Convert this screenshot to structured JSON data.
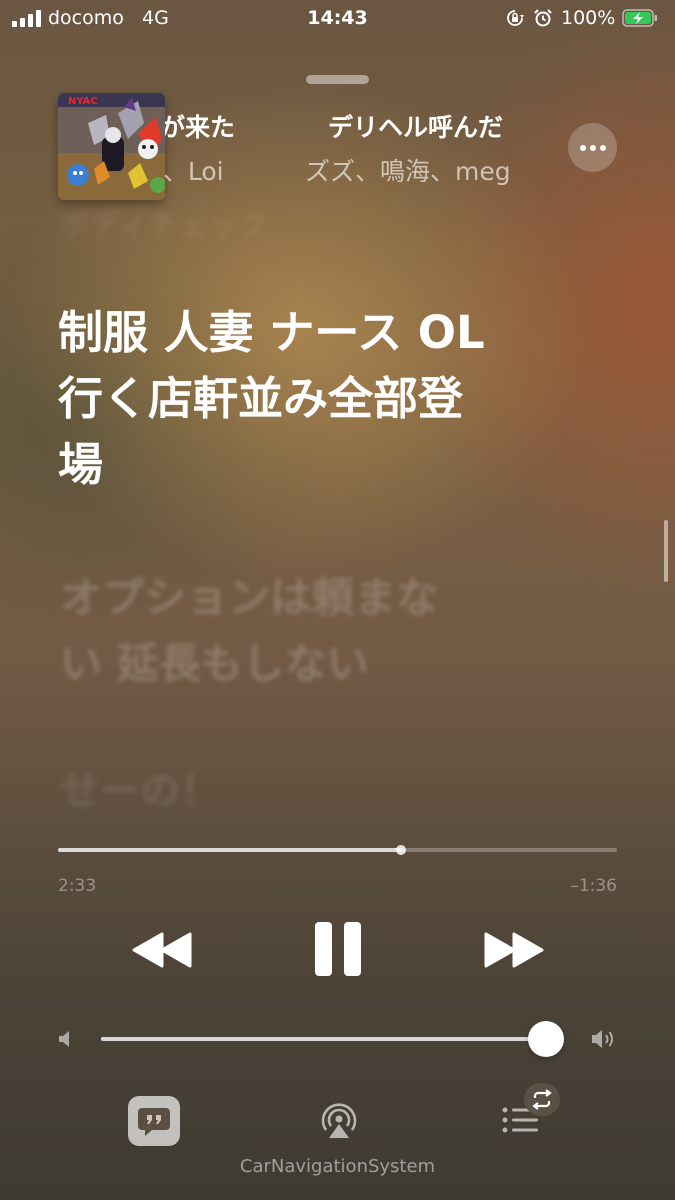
{
  "status_bar": {
    "carrier": "docomo",
    "network": "4G",
    "time": "14:43",
    "battery_percent": "100%",
    "battery_level": 1.0,
    "icons": [
      "signal-icon",
      "orientation-lock-icon",
      "alarm-icon",
      "battery-charging-icon"
    ]
  },
  "now_playing": {
    "title_fragment_1": "君が来た",
    "title_fragment_2": "デリヘル呼んだ",
    "artist_fragment_1": "n、Loi",
    "artist_fragment_2": "ズズ、鳴海、meg",
    "faded_lyric": "ボディチェック"
  },
  "lyrics": {
    "active": [
      "制服 人妻 ナース OL",
      "行く店軒並み全部登",
      "場"
    ],
    "next": [
      "オプションは頼まな",
      "い 延長もしない"
    ],
    "after": "せーの！"
  },
  "playback": {
    "elapsed": "2:33",
    "remaining": "–1:36",
    "progress_fraction": 0.614
  },
  "volume": {
    "level_fraction": 0.962
  },
  "bottom": {
    "device_label": "CarNavigationSystem"
  },
  "colors": {
    "accent": "#ffffff",
    "battery_fill": "#34c759"
  }
}
